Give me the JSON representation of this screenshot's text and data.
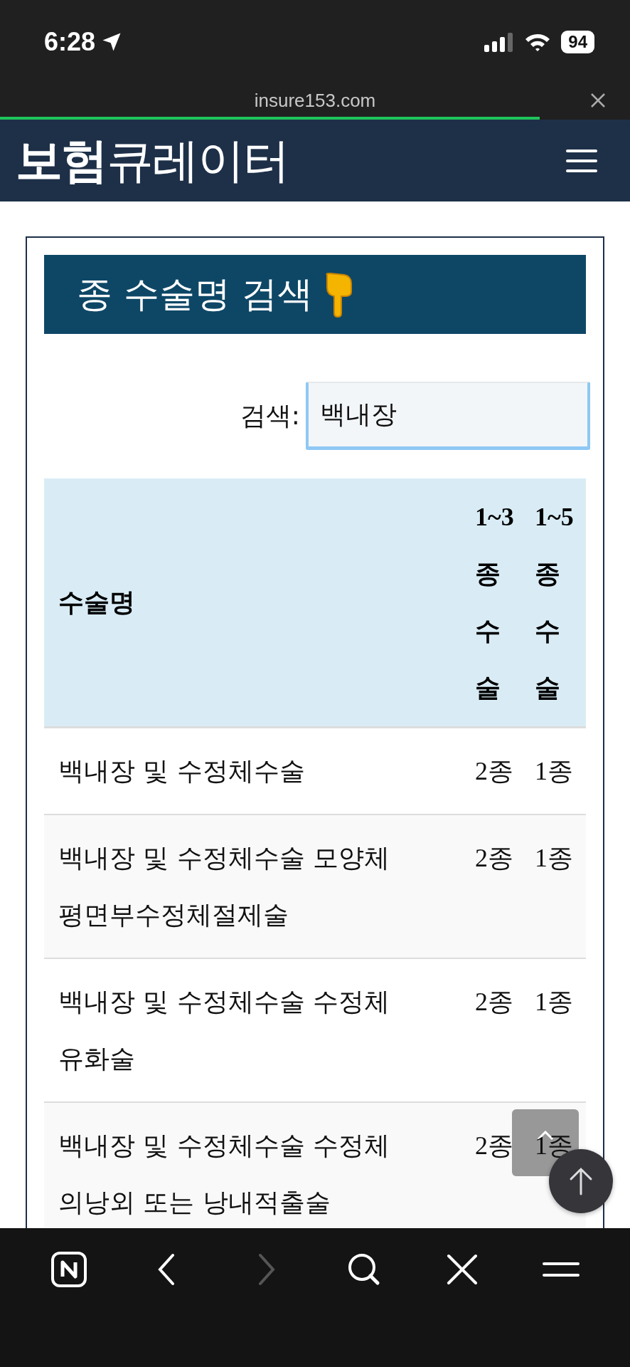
{
  "status_bar": {
    "time": "6:28",
    "battery": "94"
  },
  "browser": {
    "url": "insure153.com",
    "load": {
      "level": 0.857
    }
  },
  "site_header": {
    "logo": "**보험**큐레이터"
  },
  "panel": {
    "title": "종 수술명 검색",
    "search": {
      "label": "검색:",
      "value": "백내장"
    },
    "table": {
      "columns": [
        "수술명",
        "1~3종 수술",
        "1~5종 수술"
      ],
      "rows": [
        {
          "cells": [
            "백내장 및 수정체수술",
            "2종",
            "1종"
          ]
        },
        {
          "cells": [
            "백내장 및 수정체수술 모양체 평면부수정체절제술",
            "2종",
            "1종"
          ]
        },
        {
          "cells": [
            "백내장 및 수정체수술 수정체 유화술",
            "2종",
            "1종"
          ]
        },
        {
          "cells": [
            "백내장 및 수정체수술 수정체 의낭외 또는 낭내적출술",
            "2종",
            "1종"
          ]
        }
      ]
    }
  },
  "toolbar": [
    {
      "kind": "n-logo",
      "disabled": false
    },
    {
      "kind": "back",
      "disabled": false
    },
    {
      "kind": "forward",
      "disabled": true
    },
    {
      "kind": "search",
      "disabled": false
    },
    {
      "kind": "close",
      "disabled": false
    },
    {
      "kind": "menu",
      "disabled": false
    }
  ]
}
